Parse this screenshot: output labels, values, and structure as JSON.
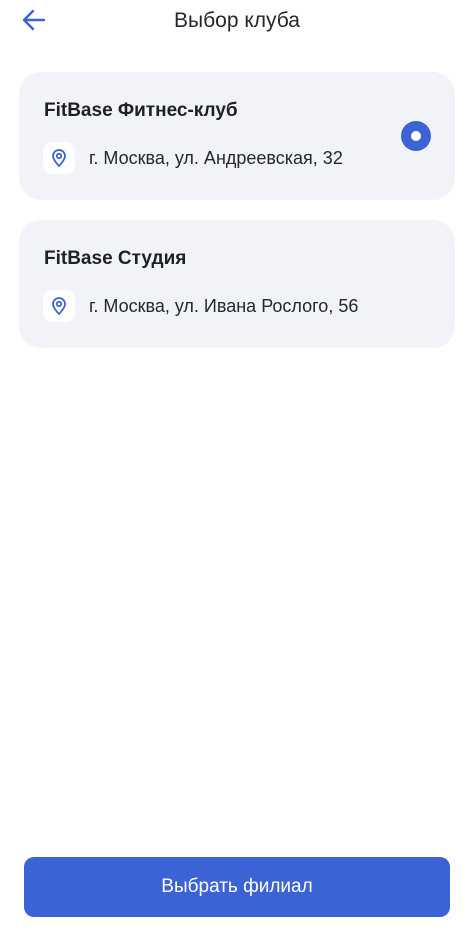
{
  "header": {
    "title": "Выбор клуба",
    "back_icon": "arrow-left-icon"
  },
  "clubs": [
    {
      "name": "FitBase Фитнес-клуб",
      "address": "г. Москва, ул. Андреевская, 32",
      "icon": "location-pin-icon",
      "selected": true
    },
    {
      "name": "FitBase Студия",
      "address": "г. Москва, ул. Ивана Рослого, 56",
      "icon": "location-pin-icon",
      "selected": false
    }
  ],
  "footer": {
    "select_label": "Выбрать филиал"
  },
  "colors": {
    "accent": "#3b63d6",
    "card_background": "#f2f3f8",
    "pin_color": "#3b63d6"
  }
}
